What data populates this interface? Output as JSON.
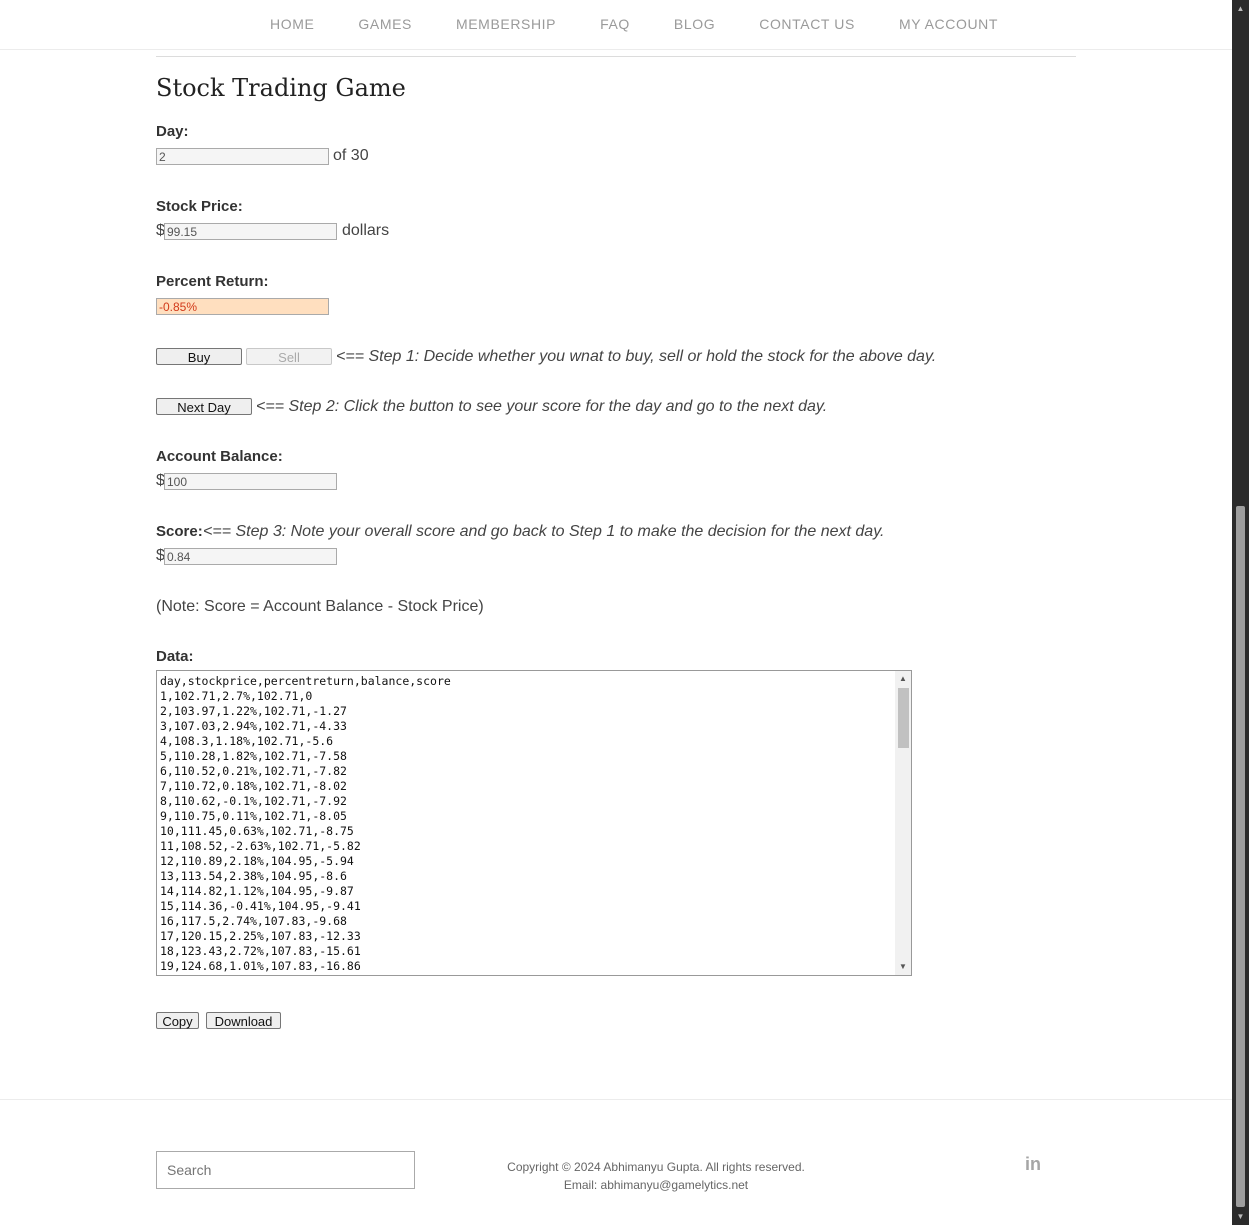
{
  "nav": {
    "items": [
      {
        "label": "HOME"
      },
      {
        "label": "GAMES"
      },
      {
        "label": "MEMBERSHIP"
      },
      {
        "label": "FAQ"
      },
      {
        "label": "BLOG"
      },
      {
        "label": "CONTACT US"
      },
      {
        "label": "MY ACCOUNT"
      }
    ]
  },
  "game": {
    "title": "Stock Trading Game",
    "day_label": "Day:",
    "day_value": "2",
    "day_suffix": "of 30",
    "price_label": "Stock Price:",
    "currency_symbol": "$",
    "price_value": "99.15",
    "price_suffix": "dollars",
    "return_label": "Percent Return:",
    "return_value": "-0.85%",
    "buy_label": "Buy",
    "sell_label": "Sell",
    "step1_hint": "<== Step 1: Decide whether you wnat to buy, sell or hold the stock for the above day.",
    "next_day_label": "Next Day",
    "step2_hint": "<== Step 2: Click the button to see your score for the day and go to the next day.",
    "balance_label": "Account Balance:",
    "balance_value": "100",
    "score_label": "Score:",
    "step3_hint": "<== Step 3: Note your overall score and go back to Step 1 to make the decision for the next day.",
    "score_value": "0.84",
    "note": "(Note: Score = Account Balance - Stock Price)",
    "data_label": "Data:",
    "data_lines": [
      "day,stockprice,percentreturn,balance,score",
      "1,102.71,2.7%,102.71,0",
      "2,103.97,1.22%,102.71,-1.27",
      "3,107.03,2.94%,102.71,-4.33",
      "4,108.3,1.18%,102.71,-5.6",
      "5,110.28,1.82%,102.71,-7.58",
      "6,110.52,0.21%,102.71,-7.82",
      "7,110.72,0.18%,102.71,-8.02",
      "8,110.62,-0.1%,102.71,-7.92",
      "9,110.75,0.11%,102.71,-8.05",
      "10,111.45,0.63%,102.71,-8.75",
      "11,108.52,-2.63%,102.71,-5.82",
      "12,110.89,2.18%,104.95,-5.94",
      "13,113.54,2.38%,104.95,-8.6",
      "14,114.82,1.12%,104.95,-9.87",
      "15,114.36,-0.41%,104.95,-9.41",
      "16,117.5,2.74%,107.83,-9.68",
      "17,120.15,2.25%,107.83,-12.33",
      "18,123.43,2.72%,107.83,-15.61",
      "19,124.68,1.01%,107.83,-16.86"
    ],
    "copy_label": "Copy",
    "download_label": "Download"
  },
  "footer": {
    "search_placeholder": "Search",
    "copyright": "Copyright © 2024 Abhimanyu Gupta. All rights reserved.",
    "email": "Email: abhimanyu@gamelytics.net",
    "linkedin_glyph": "in"
  },
  "colors": {
    "warning_bg": "#ffdfbf",
    "warning_text": "#d23a1a"
  },
  "icons": {
    "social": "linkedin-icon",
    "scroll_up": "arrow-up-icon",
    "scroll_down": "arrow-down-icon"
  }
}
